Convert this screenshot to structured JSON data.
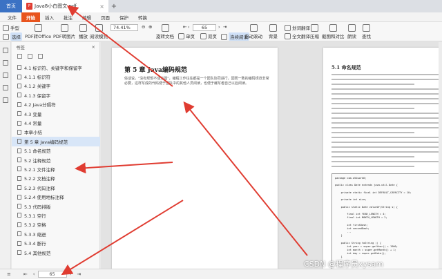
{
  "tabs": {
    "home": "首页",
    "doc": "Java8小白图文.pdf",
    "close": "×",
    "add": "+"
  },
  "menu": [
    "文件",
    "开始",
    "插入",
    "批注",
    "编辑",
    "页面",
    "保护",
    "转换"
  ],
  "menu_active_index": 1,
  "toolbar": {
    "hand": "手型",
    "select": "选择",
    "pdf_office": "PDF转Office",
    "pdf_image": "PDF转图片",
    "play": "播放",
    "read_mode": "阅读模式",
    "zoom": "74.41%",
    "page_current": "65",
    "rotate": "旋转文档",
    "single": "单页",
    "double": "双页",
    "continuous": "连续阅读",
    "auto_scroll": "自动滚动",
    "background": "背景",
    "translate": "划词翻译",
    "full_translate": "全文翻译",
    "compress": "压缩",
    "capture": "截图和对比",
    "read_aloud": "朗读",
    "find": "查找"
  },
  "outline": {
    "header": "书签",
    "close": "×",
    "items": [
      {
        "label": "4.1   标识符、关键字和保留字",
        "selected": false
      },
      {
        "label": "4.1.1   标识符",
        "selected": false
      },
      {
        "label": "4.1.2   关键字",
        "selected": false
      },
      {
        "label": "4.1.3   保留字",
        "selected": false
      },
      {
        "label": "4.2   Java分隔符",
        "selected": false
      },
      {
        "label": "4.3   变量",
        "selected": false
      },
      {
        "label": "4.4   常量",
        "selected": false
      },
      {
        "label": "本章小结",
        "selected": false
      },
      {
        "label": "第 5 章   Java编码规范",
        "selected": true
      },
      {
        "label": "5.1   命名规范",
        "selected": false
      },
      {
        "label": "5.2   注释规范",
        "selected": false
      },
      {
        "label": "5.2.1   文件注释",
        "selected": false
      },
      {
        "label": "5.2.2   文档注释",
        "selected": false
      },
      {
        "label": "5.2.3   代码注释",
        "selected": false
      },
      {
        "label": "5.2.4   使用地标注释",
        "selected": false
      },
      {
        "label": "5.3   代码排版",
        "selected": false
      },
      {
        "label": "5.3.1   空行",
        "selected": false
      },
      {
        "label": "5.3.2   空格",
        "selected": false
      },
      {
        "label": "5.3.3   缩进",
        "selected": false
      },
      {
        "label": "5.3.4   断行",
        "selected": false
      },
      {
        "label": "5.4   其他规范",
        "selected": false
      }
    ]
  },
  "page1": {
    "title": "第 5 章   Java编码规范",
    "text": "俗话说，\"没有规矩不成方圆\"，编程工作往往都是一个团队协同进行，因而一致的编码规范非常必要，这样写成的代码便于团队中的其他人员阅读，也便于编写者自己以后阅读。"
  },
  "page2": {
    "title": "5.1   命名规范",
    "code": "package com.a51work6;\n\npublic class Date extends java.util.Date {\n\n    private static final int DEFAULT_CAPACITY = 10;\n\n    private int size;\n\n    public static Date valueOf(String s) {\n\n        final int YEAR_LENGTH = 4;\n        final int MONTH_LENGTH = 2;\n\n        int firstDash;\n        int secondDash;\n        ...\n    }\n\n    public String toString () {\n        int year = super.getYear() + 1900;\n        int month = super.getMonth() + 1;\n        int day = super.getDate();\n    }"
  },
  "status": {
    "page": "65"
  },
  "watermark": "CSDN @程序员xysam",
  "colors": {
    "accent": "#e8541e",
    "tab_home": "#3b72c4",
    "selection": "#d8e6f8",
    "arrow": "#e03c31"
  }
}
